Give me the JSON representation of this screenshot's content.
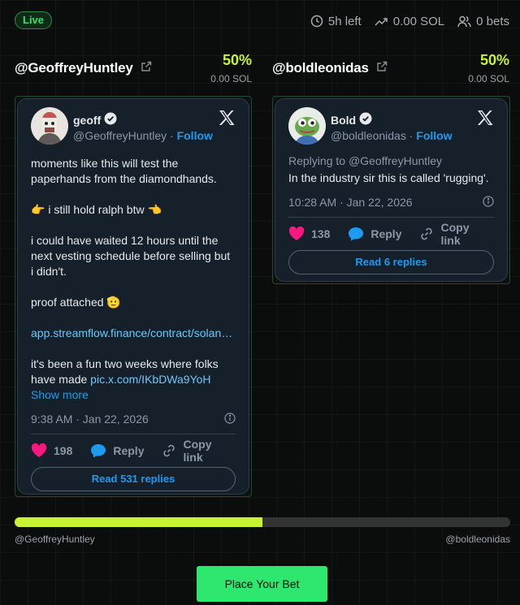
{
  "status": {
    "live_label": "Live"
  },
  "stats": {
    "time_left": "5h left",
    "volume": "0.00 SOL",
    "bets": "0 bets"
  },
  "sides": [
    {
      "handle": "@GeoffreyHuntley",
      "percent": "50%",
      "sol": "0.00 SOL",
      "fill_fraction": 0.5
    },
    {
      "handle": "@boldleonidas",
      "percent": "50%",
      "sol": "0.00 SOL"
    }
  ],
  "tweets": [
    {
      "name": "geoff",
      "handle": "@GeoffreyHuntley",
      "separator": "·",
      "follow": "Follow",
      "paragraphs": [
        "moments like this will test the paperhands from the diamondhands.",
        "👉 i still hold ralph btw 👈",
        "i could have waited 12 hours until the next vesting schedule before selling but i didn't.",
        "proof attached 🫡"
      ],
      "link": "app.streamflow.finance/contract/solan…",
      "final_text": "it's been a fun two weeks where folks have made ",
      "media_link": "pic.x.com/IKbDWa9YoH",
      "show_more": "Show more",
      "time": "9:38 AM · Jan 22, 2026",
      "likes": "198",
      "reply_label": "Reply",
      "copy_label": "Copy link",
      "read_replies": "Read 531 replies"
    },
    {
      "name": "Bold",
      "handle": "@boldleonidas",
      "separator": "·",
      "follow": "Follow",
      "replying_to_prefix": "Replying to ",
      "replying_to_handle": "@GeoffreyHuntley",
      "text": "In the industry sir this is called 'rugging'.",
      "time": "10:28 AM · Jan 22, 2026",
      "likes": "138",
      "reply_label": "Reply",
      "copy_label": "Copy link",
      "read_replies": "Read 6 replies"
    }
  ],
  "progress_labels": {
    "left": "@GeoffreyHuntley",
    "right": "@boldleonidas"
  },
  "bet_button": "Place Your Bet",
  "colors": {
    "accent": "#c6f432",
    "live": "#37e26a",
    "bet": "#2ee76f",
    "link": "#1d9bf0"
  }
}
